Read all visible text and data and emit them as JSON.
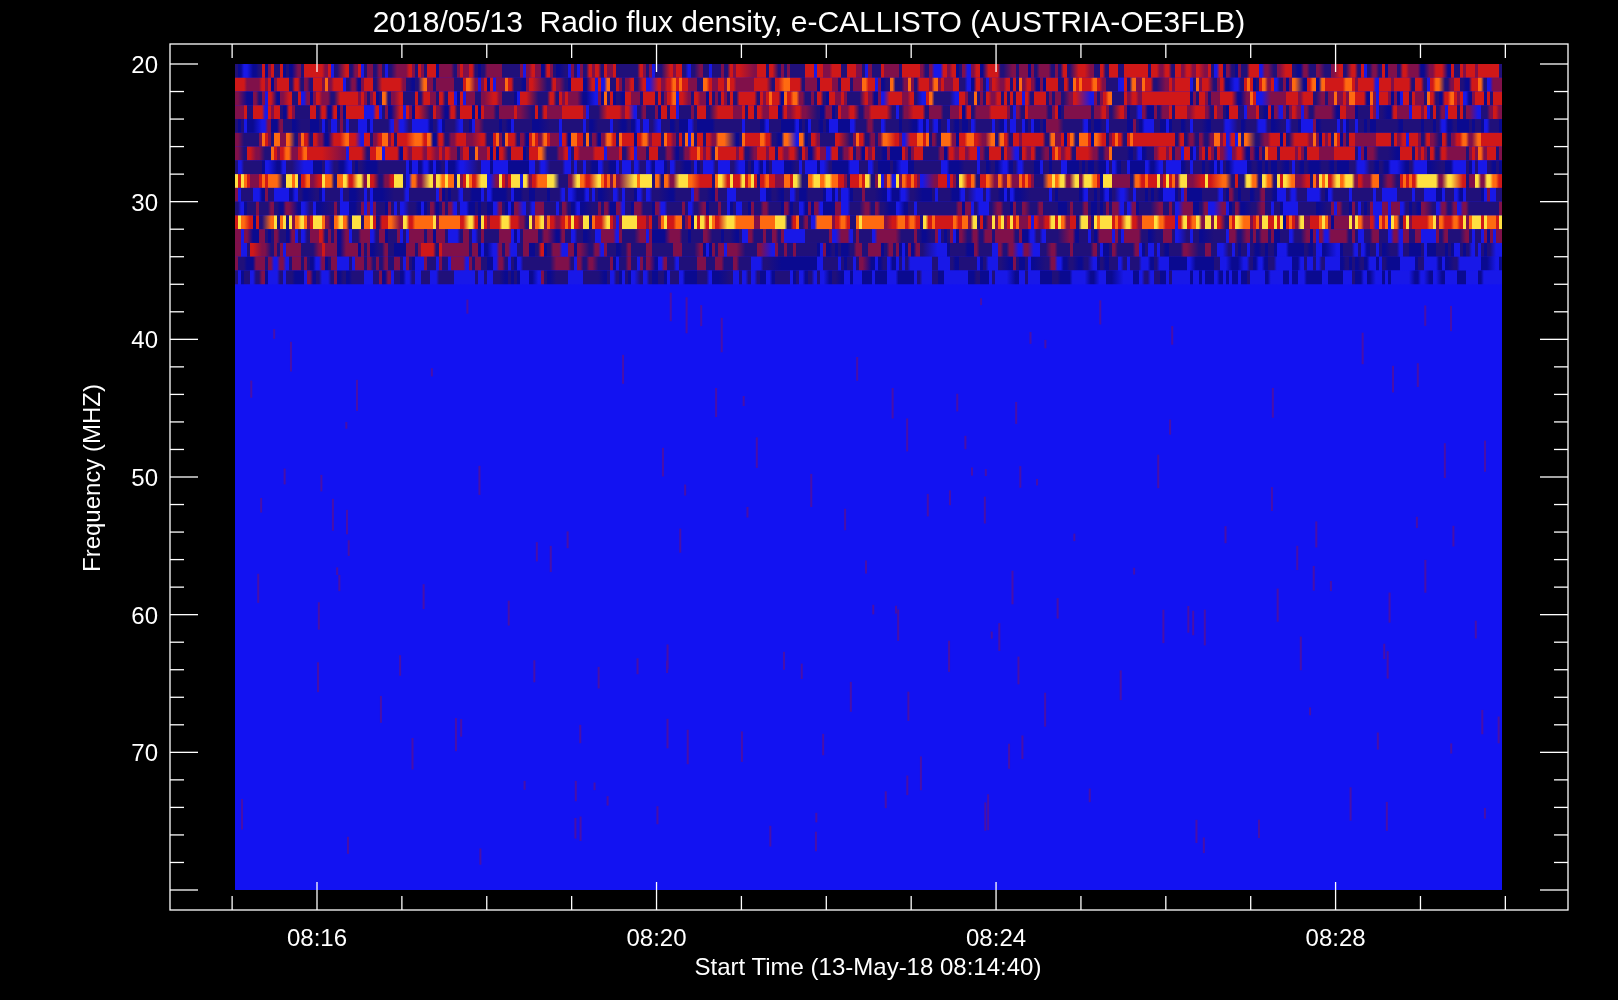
{
  "title": "2018/05/13  Radio flux density, e-CALLISTO (AUSTRIA-OE3FLB)",
  "plot": {
    "ylabel": "Frequency (MHZ)",
    "xlabel": "Start Time (13-May-18 08:14:40)",
    "y_tick_labels": [
      "20",
      "30",
      "40",
      "50",
      "60",
      "70"
    ],
    "x_tick_labels": [
      "08:16",
      "08:20",
      "08:24",
      "08:28"
    ]
  }
}
